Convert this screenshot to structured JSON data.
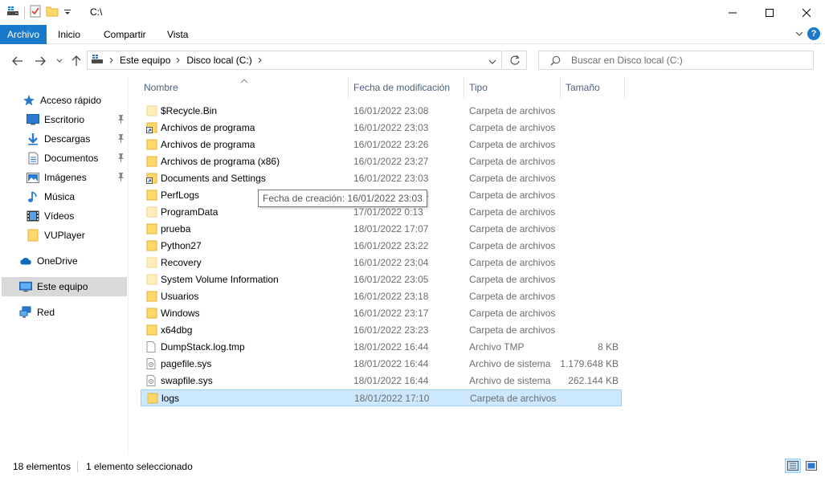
{
  "window": {
    "title": "C:\\"
  },
  "ribbon": {
    "tabs": [
      "Archivo",
      "Inicio",
      "Compartir",
      "Vista"
    ]
  },
  "address": {
    "crumbs": [
      "Este equipo",
      "Disco local (C:)"
    ]
  },
  "search": {
    "placeholder": "Buscar en Disco local (C:)"
  },
  "sidebar": {
    "quick_access": "Acceso rápido",
    "items": [
      {
        "label": "Escritorio",
        "icon": "desktop-icon",
        "pinned": true
      },
      {
        "label": "Descargas",
        "icon": "download-icon",
        "pinned": true
      },
      {
        "label": "Documentos",
        "icon": "document-icon",
        "pinned": true
      },
      {
        "label": "Imágenes",
        "icon": "pictures-icon",
        "pinned": true
      },
      {
        "label": "Música",
        "icon": "music-icon",
        "pinned": false
      },
      {
        "label": "Vídeos",
        "icon": "video-icon",
        "pinned": false
      },
      {
        "label": "VUPlayer",
        "icon": "folder-icon",
        "pinned": false
      }
    ],
    "onedrive": "OneDrive",
    "this_pc": "Este equipo",
    "network": "Red"
  },
  "columns": {
    "name": "Nombre",
    "date": "Fecha de modificación",
    "type": "Tipo",
    "size": "Tamaño"
  },
  "files": [
    {
      "name": "$Recycle.Bin",
      "date": "16/01/2022 23:08",
      "type": "Carpeta de archivos",
      "size": "",
      "icon": "folder-faded"
    },
    {
      "name": "Archivos de programa",
      "date": "16/01/2022 23:03",
      "type": "Carpeta de archivos",
      "size": "",
      "icon": "shortcut"
    },
    {
      "name": "Archivos de programa",
      "date": "16/01/2022 23:26",
      "type": "Carpeta de archivos",
      "size": "",
      "icon": "folder"
    },
    {
      "name": "Archivos de programa (x86)",
      "date": "16/01/2022 23:27",
      "type": "Carpeta de archivos",
      "size": "",
      "icon": "folder"
    },
    {
      "name": "Documents and Settings",
      "date": "16/01/2022 23:03",
      "type": "Carpeta de archivos",
      "size": "",
      "icon": "shortcut"
    },
    {
      "name": "PerfLogs",
      "date": "16/01/2022 23:04",
      "type": "Carpeta de archivos",
      "size": "",
      "icon": "folder"
    },
    {
      "name": "ProgramData",
      "date": "17/01/2022 0:13",
      "type": "Carpeta de archivos",
      "size": "",
      "icon": "folder-faded"
    },
    {
      "name": "prueba",
      "date": "18/01/2022 17:07",
      "type": "Carpeta de archivos",
      "size": "",
      "icon": "folder"
    },
    {
      "name": "Python27",
      "date": "16/01/2022 23:22",
      "type": "Carpeta de archivos",
      "size": "",
      "icon": "folder"
    },
    {
      "name": "Recovery",
      "date": "16/01/2022 23:04",
      "type": "Carpeta de archivos",
      "size": "",
      "icon": "folder-faded"
    },
    {
      "name": "System Volume Information",
      "date": "16/01/2022 23:05",
      "type": "Carpeta de archivos",
      "size": "",
      "icon": "folder-faded"
    },
    {
      "name": "Usuarios",
      "date": "16/01/2022 23:18",
      "type": "Carpeta de archivos",
      "size": "",
      "icon": "folder"
    },
    {
      "name": "Windows",
      "date": "16/01/2022 23:17",
      "type": "Carpeta de archivos",
      "size": "",
      "icon": "folder"
    },
    {
      "name": "x64dbg",
      "date": "16/01/2022 23:23",
      "type": "Carpeta de archivos",
      "size": "",
      "icon": "folder"
    },
    {
      "name": "DumpStack.log.tmp",
      "date": "18/01/2022 16:44",
      "type": "Archivo TMP",
      "size": "8 KB",
      "icon": "file"
    },
    {
      "name": "pagefile.sys",
      "date": "18/01/2022 16:44",
      "type": "Archivo de sistema",
      "size": "1.179.648 KB",
      "icon": "sysfile"
    },
    {
      "name": "swapfile.sys",
      "date": "18/01/2022 16:44",
      "type": "Archivo de sistema",
      "size": "262.144 KB",
      "icon": "sysfile"
    },
    {
      "name": "logs",
      "date": "18/01/2022 17:10",
      "type": "Carpeta de archivos",
      "size": "",
      "icon": "folder",
      "selected": true
    }
  ],
  "tooltip": "Fecha de creación: 16/01/2022 23:03",
  "status": {
    "count": "18 elementos",
    "selection": "1 elemento seleccionado"
  },
  "colors": {
    "accent": "#1979ca",
    "selection": "#cce8ff",
    "selection_border": "#99d1ff",
    "folder": "#ffd86b",
    "header_text": "#4c607a"
  }
}
